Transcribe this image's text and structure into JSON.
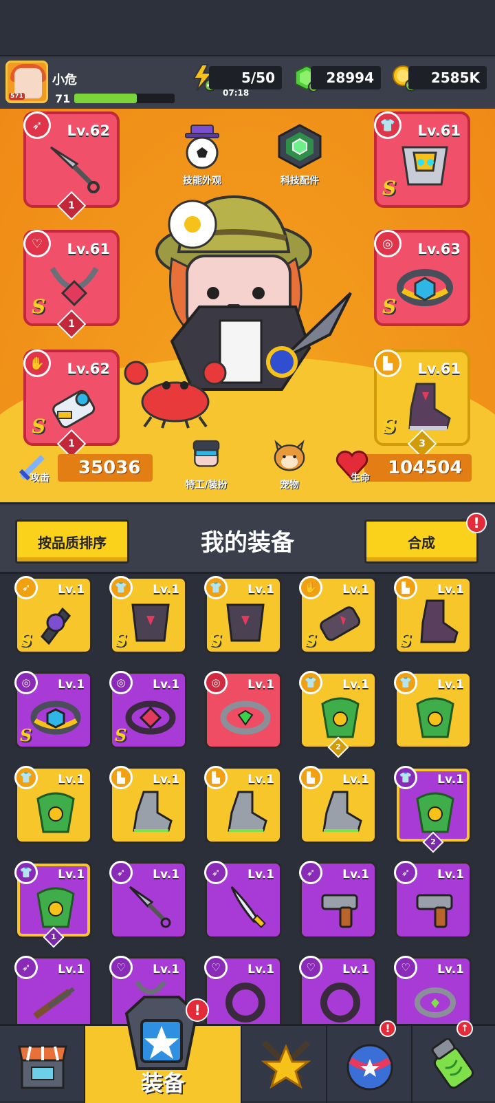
{
  "player": {
    "name": "小危",
    "level": "71",
    "avatar_badge": "571",
    "xp_fraction": 0.62
  },
  "resources": {
    "energy": {
      "value": "5/50",
      "timer": "07:18",
      "icon": "lightning-icon"
    },
    "gems": {
      "value": "28994",
      "icon": "green-gem-icon"
    },
    "coins": {
      "value": "2585K",
      "icon": "gold-coin-icon"
    }
  },
  "features": {
    "skill_skin": "技能外观",
    "tech_parts": "科技配件",
    "agent_outfit": "特工/装扮",
    "pet": "宠物"
  },
  "stats": {
    "attack_label": "攻击",
    "attack_value": "35036",
    "hp_label": "生命",
    "hp_value": "104504"
  },
  "equipped": {
    "weapon": {
      "level": "Lv.62",
      "count": "1",
      "grade": ""
    },
    "armor": {
      "level": "Lv.61",
      "count": "",
      "grade": "S"
    },
    "necklace": {
      "level": "Lv.61",
      "count": "1",
      "grade": "S"
    },
    "belt": {
      "level": "Lv.63",
      "count": "",
      "grade": "S"
    },
    "gloves": {
      "level": "Lv.62",
      "count": "1",
      "grade": "S"
    },
    "boots": {
      "level": "Lv.61",
      "count": "3",
      "grade": "S"
    }
  },
  "section": {
    "sort_button": "按品质排序",
    "title": "我的装备",
    "merge_button": "合成",
    "merge_alert": "!"
  },
  "inventory": [
    {
      "level": "Lv.1",
      "grade": "S",
      "color": "y",
      "count": ""
    },
    {
      "level": "Lv.1",
      "grade": "S",
      "color": "y",
      "count": ""
    },
    {
      "level": "Lv.1",
      "grade": "S",
      "color": "y",
      "count": ""
    },
    {
      "level": "Lv.1",
      "grade": "S",
      "color": "y",
      "count": ""
    },
    {
      "level": "Lv.1",
      "grade": "S",
      "color": "y",
      "count": ""
    },
    {
      "level": "Lv.1",
      "grade": "S",
      "color": "p",
      "count": ""
    },
    {
      "level": "Lv.1",
      "grade": "S",
      "color": "p",
      "count": ""
    },
    {
      "level": "Lv.1",
      "grade": "",
      "color": "r",
      "count": ""
    },
    {
      "level": "Lv.1",
      "grade": "",
      "color": "y",
      "count": "2"
    },
    {
      "level": "Lv.1",
      "grade": "",
      "color": "y",
      "count": ""
    },
    {
      "level": "Lv.1",
      "grade": "",
      "color": "y",
      "count": ""
    },
    {
      "level": "Lv.1",
      "grade": "",
      "color": "y",
      "count": ""
    },
    {
      "level": "Lv.1",
      "grade": "",
      "color": "y",
      "count": ""
    },
    {
      "level": "Lv.1",
      "grade": "",
      "color": "y",
      "count": ""
    },
    {
      "level": "Lv.1",
      "grade": "",
      "color": "p",
      "count": "2"
    },
    {
      "level": "Lv.1",
      "grade": "",
      "color": "p",
      "count": "1"
    },
    {
      "level": "Lv.1",
      "grade": "",
      "color": "p",
      "count": ""
    },
    {
      "level": "Lv.1",
      "grade": "",
      "color": "p",
      "count": ""
    },
    {
      "level": "Lv.1",
      "grade": "",
      "color": "p",
      "count": ""
    },
    {
      "level": "Lv.1",
      "grade": "",
      "color": "p",
      "count": ""
    },
    {
      "level": "Lv.1",
      "grade": "",
      "color": "p",
      "count": ""
    },
    {
      "level": "Lv.1",
      "grade": "",
      "color": "p",
      "count": ""
    },
    {
      "level": "Lv.1",
      "grade": "",
      "color": "p",
      "count": ""
    },
    {
      "level": "Lv.1",
      "grade": "",
      "color": "p",
      "count": ""
    },
    {
      "level": "Lv.1",
      "grade": "",
      "color": "p",
      "count": ""
    }
  ],
  "nav": {
    "equipment_label": "装备",
    "alert": "!"
  }
}
